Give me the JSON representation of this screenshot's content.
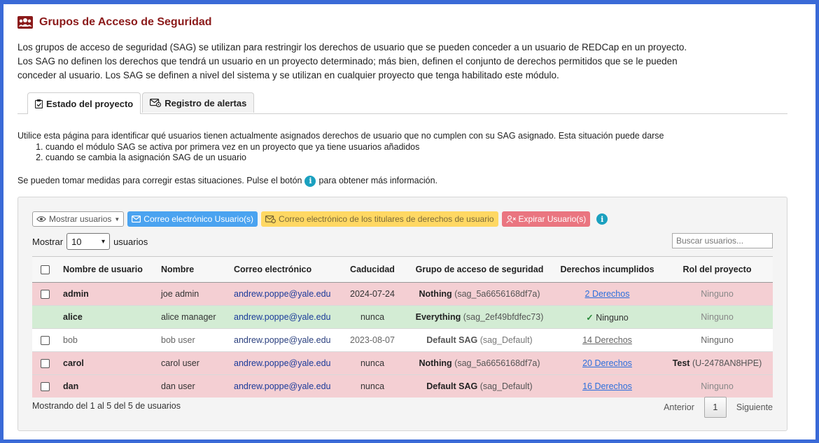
{
  "header": {
    "title": "Grupos de Acceso de Seguridad",
    "intro": "Los grupos de acceso de seguridad (SAG) se utilizan para restringir los derechos de usuario que se pueden conceder a un usuario de REDCap en un proyecto. Los SAG no definen los derechos que tendrá un usuario en un proyecto determinado; más bien, definen el conjunto de derechos permitidos que se le pueden conceder al usuario. Los SAG se definen a nivel del sistema y se utilizan en cualquier proyecto que tenga habilitado este módulo."
  },
  "tabs": [
    {
      "label": "Estado del proyecto",
      "icon": "clipboard-check-icon",
      "active": true
    },
    {
      "label": "Registro de alertas",
      "icon": "envelope-gear-icon",
      "active": false
    }
  ],
  "description": {
    "lead": "Utilice esta página para identificar qué usuarios tienen actualmente asignados derechos de usuario que no cumplen con su SAG asignado. Esta situación puede darse",
    "items": [
      "cuando el módulo SAG se activa por primera vez en un proyecto que ya tiene usuarios añadidos",
      "cuando se cambia la asignación SAG de un usuario"
    ],
    "note_before": "Se pueden tomar medidas para corregir estas situaciones. Pulse el botón",
    "note_after": "para obtener más información."
  },
  "toolbar": {
    "show_users": "Mostrar usuarios",
    "email_users": "Correo electrónico Usuario(s)",
    "email_rights_holders": "Correo electrónico de los titulares de derechos de usuario",
    "expire_users": "Expirar Usuario(s)"
  },
  "length": {
    "prefix": "Mostrar",
    "value": "10",
    "suffix": "usuarios"
  },
  "search": {
    "placeholder": "Buscar usuarios..."
  },
  "table": {
    "columns": [
      "Nombre de usuario",
      "Nombre",
      "Correo electrónico",
      "Caducidad",
      "Grupo de acceso de seguridad",
      "Derechos incumplidos",
      "Rol del proyecto"
    ],
    "rows": [
      {
        "status": "red",
        "username": "admin",
        "name": "joe admin",
        "email": "andrew.poppe@yale.edu",
        "expiration": "2024-07-24",
        "sag_name": "Nothing",
        "sag_id": "(sag_5a6656168df7a)",
        "rights": "2 Derechos",
        "role": "Ninguno",
        "role_id": ""
      },
      {
        "status": "green",
        "username": "alice",
        "name": "alice manager",
        "email": "andrew.poppe@yale.edu",
        "expiration": "nunca",
        "sag_name": "Everything",
        "sag_id": "(sag_2ef49bfdfec73)",
        "rights": "Ninguno",
        "role": "Ninguno",
        "role_id": ""
      },
      {
        "status": "white",
        "username": "bob",
        "name": "bob user",
        "email": "andrew.poppe@yale.edu",
        "expiration": "2023-08-07",
        "sag_name": "Default SAG",
        "sag_id": "(sag_Default)",
        "rights": "14 Derechos",
        "role": "Ninguno",
        "role_id": ""
      },
      {
        "status": "red",
        "username": "carol",
        "name": "carol user",
        "email": "andrew.poppe@yale.edu",
        "expiration": "nunca",
        "sag_name": "Nothing",
        "sag_id": "(sag_5a6656168df7a)",
        "rights": "20 Derechos",
        "role": "Test",
        "role_id": "(U-2478AN8HPE)"
      },
      {
        "status": "red",
        "username": "dan",
        "name": "dan user",
        "email": "andrew.poppe@yale.edu",
        "expiration": "nunca",
        "sag_name": "Default SAG",
        "sag_id": "(sag_Default)",
        "rights": "16 Derechos",
        "role": "Ninguno",
        "role_id": ""
      }
    ]
  },
  "footer": {
    "info": "Mostrando del 1 al 5 del 5 de usuarios",
    "previous": "Anterior",
    "page": "1",
    "next": "Siguiente"
  },
  "colors": {
    "title": "#8b1a1a",
    "frame": "#3a6ad7",
    "row_error": "#f4cfd3",
    "row_ok": "#d3ecd4",
    "btn_blue": "#4aa3f0",
    "btn_yellow": "#ffd863",
    "btn_red": "#ea7580",
    "info": "#1aa0bf"
  }
}
